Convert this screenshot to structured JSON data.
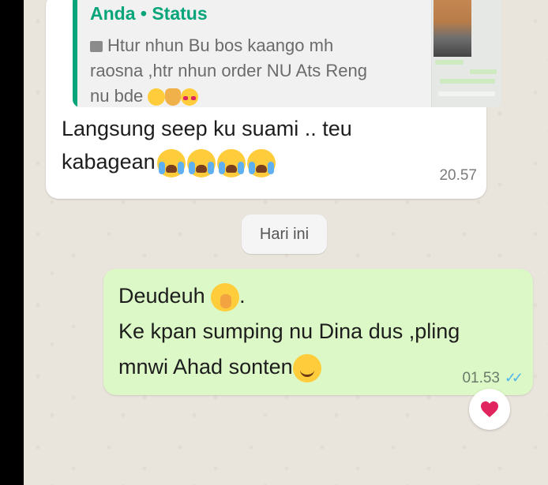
{
  "incoming": {
    "quote": {
      "author": "Anda",
      "separator": "•",
      "type": "Status",
      "text": "Htur nhun Bu bos kaango mh raosna ,htr nhun order NU Ats Reng nu bde",
      "emoji": [
        "grinning-sweat-emoji",
        "folded-hands-emoji",
        "smiling-hearts-emoji"
      ]
    },
    "message": "Langsung seep ku suami .. teu kabagean",
    "time": "20.57"
  },
  "date_divider": "Hari ini",
  "outgoing": {
    "line1": "Deudeuh",
    "line1_suffix": ".",
    "line2": "Ke kpan sumping nu Dina dus ,pling mnwi Ahad sonten",
    "time": "01.53",
    "status": "read"
  },
  "reaction": "heart",
  "colors": {
    "accent": "#08a57a",
    "outgoing_bubble": "#dcf8c6",
    "read_ticks": "#4fb6ec",
    "heart": "#e0245e"
  }
}
